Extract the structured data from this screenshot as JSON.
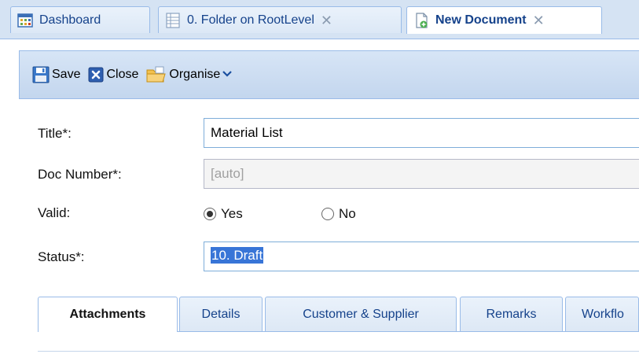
{
  "tabs": [
    {
      "label": "Dashboard",
      "icon": "dashboard-icon",
      "closable": false,
      "active": false
    },
    {
      "label": "0. Folder on RootLevel",
      "icon": "folder-grid-icon",
      "closable": true,
      "active": false
    },
    {
      "label": "New Document",
      "icon": "new-document-icon",
      "closable": true,
      "active": true
    }
  ],
  "toolbar": {
    "save_label": "Save",
    "close_label": "Close",
    "organise_label": "Organise"
  },
  "form": {
    "title_label": "Title*:",
    "title_value": "Material List",
    "doc_number_label": "Doc Number*:",
    "doc_number_value": "[auto]",
    "valid_label": "Valid:",
    "valid_yes": "Yes",
    "valid_no": "No",
    "valid_selected": "Yes",
    "status_label": "Status*:",
    "status_value": "10. Draft"
  },
  "detail_tabs": [
    {
      "label": "Attachments",
      "active": true
    },
    {
      "label": "Details",
      "active": false
    },
    {
      "label": "Customer & Supplier",
      "active": false
    },
    {
      "label": "Remarks",
      "active": false
    },
    {
      "label": "Workflo",
      "active": false
    }
  ],
  "colors": {
    "accent": "#15428b",
    "border": "#99bbe8",
    "selection": "#3875d7"
  }
}
